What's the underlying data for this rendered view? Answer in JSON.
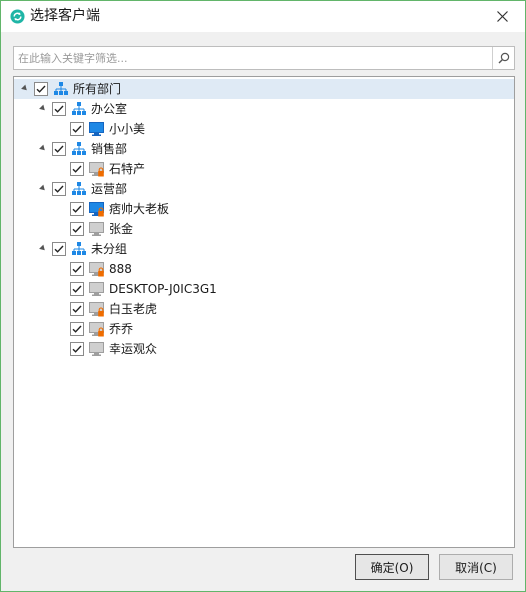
{
  "window": {
    "title": "选择客户端",
    "close_icon": "close-icon",
    "app_icon": "refresh-circle-icon"
  },
  "search": {
    "placeholder": "在此输入关键字筛选...",
    "value": "",
    "icon": "search-icon"
  },
  "tree": [
    {
      "label": "所有部门",
      "type": "group",
      "level": 0,
      "expanded": true,
      "checked": true,
      "selected": true
    },
    {
      "label": "办公室",
      "type": "group",
      "level": 1,
      "expanded": true,
      "checked": true
    },
    {
      "label": "小小美",
      "type": "client",
      "status": "online",
      "level": 2,
      "checked": true
    },
    {
      "label": "销售部",
      "type": "group",
      "level": 1,
      "expanded": true,
      "checked": true
    },
    {
      "label": "石特产",
      "type": "client",
      "status": "offline-locked",
      "level": 2,
      "checked": true
    },
    {
      "label": "运营部",
      "type": "group",
      "level": 1,
      "expanded": true,
      "checked": true
    },
    {
      "label": "痞帅大老板",
      "type": "client",
      "status": "online-locked",
      "level": 2,
      "checked": true
    },
    {
      "label": "张金",
      "type": "client",
      "status": "offline",
      "level": 2,
      "checked": true
    },
    {
      "label": "未分组",
      "type": "group",
      "level": 1,
      "expanded": true,
      "checked": true
    },
    {
      "label": "888",
      "type": "client",
      "status": "offline-locked",
      "level": 2,
      "checked": true
    },
    {
      "label": "DESKTOP-J0IC3G1",
      "type": "client",
      "status": "offline",
      "level": 2,
      "checked": true
    },
    {
      "label": "白玉老虎",
      "type": "client",
      "status": "offline-locked",
      "level": 2,
      "checked": true
    },
    {
      "label": "乔乔",
      "type": "client",
      "status": "offline-locked",
      "level": 2,
      "checked": true
    },
    {
      "label": "幸运观众",
      "type": "client",
      "status": "offline",
      "level": 2,
      "checked": true
    }
  ],
  "buttons": {
    "ok": "确定(O)",
    "cancel": "取消(C)"
  },
  "colors": {
    "border": "#62b56a",
    "selected_row": "#dfeaf5",
    "online_monitor": "#1e88e5",
    "lock": "#ef6c00",
    "org_icon": "#1e88e5"
  }
}
